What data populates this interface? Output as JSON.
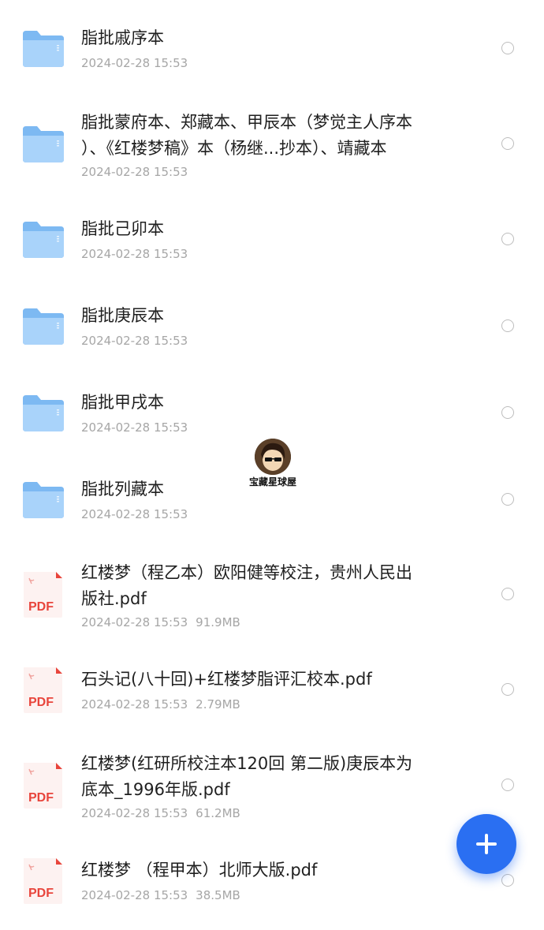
{
  "files": [
    {
      "type": "folder",
      "name": "脂批戚序本",
      "date": "2024-02-28 15:53",
      "size": ""
    },
    {
      "type": "folder",
      "name": "脂批蒙府本、郑藏本、甲辰本（梦觉主人序本\n）、《红楼梦稿》本（杨继...抄本）、靖藏本",
      "date": "2024-02-28 15:53",
      "size": ""
    },
    {
      "type": "folder",
      "name": "脂批己卯本",
      "date": "2024-02-28 15:53",
      "size": ""
    },
    {
      "type": "folder",
      "name": "脂批庚辰本",
      "date": "2024-02-28 15:53",
      "size": ""
    },
    {
      "type": "folder",
      "name": "脂批甲戌本",
      "date": "2024-02-28 15:53",
      "size": ""
    },
    {
      "type": "folder",
      "name": "脂批列藏本",
      "date": "2024-02-28 15:53",
      "size": ""
    },
    {
      "type": "pdf",
      "name": "红楼梦（程乙本）欧阳健等校注，贵州人民出\n版社.pdf",
      "date": "2024-02-28 15:53",
      "size": "91.9MB"
    },
    {
      "type": "pdf",
      "name": "石头记(八十回)+红楼梦脂评汇校本.pdf",
      "date": "2024-02-28 15:53",
      "size": "2.79MB"
    },
    {
      "type": "pdf",
      "name": "红楼梦(红研所校注本120回 第二版)庚辰本为\n底本_1996年版.pdf",
      "date": "2024-02-28 15:53",
      "size": "61.2MB"
    },
    {
      "type": "pdf",
      "name": "红楼梦 （程甲本）北师大版.pdf",
      "date": "2024-02-28 15:53",
      "size": "38.5MB"
    }
  ],
  "pdf_icon_label": "PDF",
  "fab_icon": "plus-icon",
  "watermark_text": "宝藏星球屋",
  "colors": {
    "folder": "#8cc4f5",
    "pdf_red": "#e8453c",
    "accent": "#2a6ff2"
  }
}
